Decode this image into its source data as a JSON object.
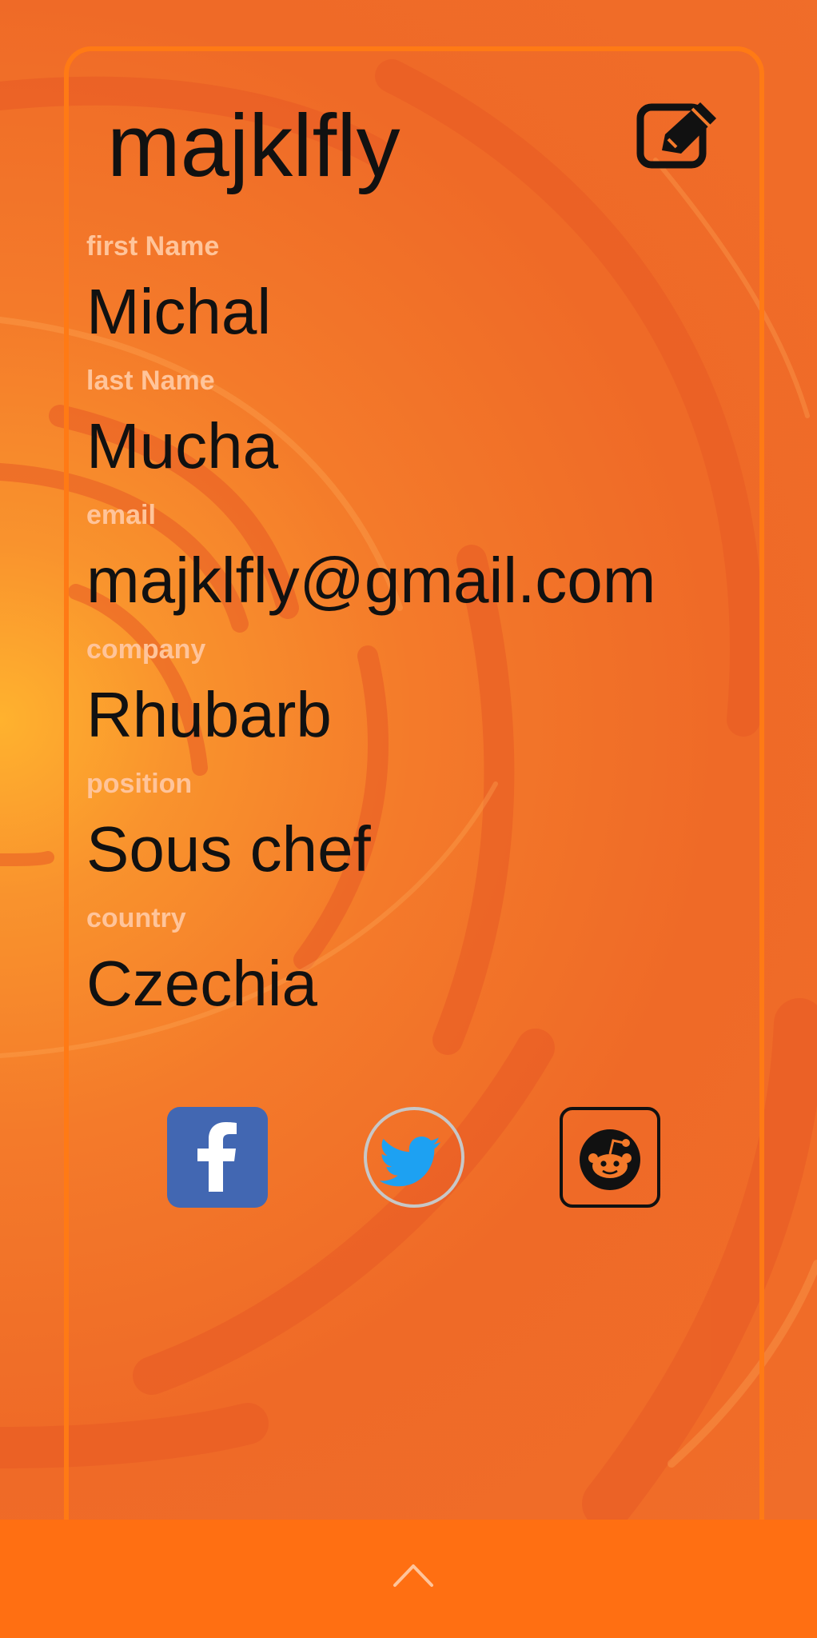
{
  "profile": {
    "username": "majklfly",
    "edit_icon": "edit-icon"
  },
  "fields": [
    {
      "label": "first Name",
      "value": "Michal"
    },
    {
      "label": "last Name",
      "value": "Mucha"
    },
    {
      "label": "email",
      "value": "majklfly@gmail.com"
    },
    {
      "label": "company",
      "value": "Rhubarb"
    },
    {
      "label": "position",
      "value": "Sous chef"
    },
    {
      "label": "country",
      "value": "Czechia"
    }
  ],
  "social": {
    "facebook_icon": "facebook-icon",
    "twitter_icon": "twitter-icon",
    "reddit_icon": "reddit-icon"
  },
  "bottom_bar": {
    "chevron_icon": "chevron-up-icon"
  },
  "colors": {
    "background_orange": "#f47a2a",
    "frame_orange": "#ff7a15",
    "label_color": "#ffc49a",
    "bottom_bar": "#ff6f12",
    "facebook_blue": "#4267b2",
    "twitter_blue": "#1da1f2"
  }
}
